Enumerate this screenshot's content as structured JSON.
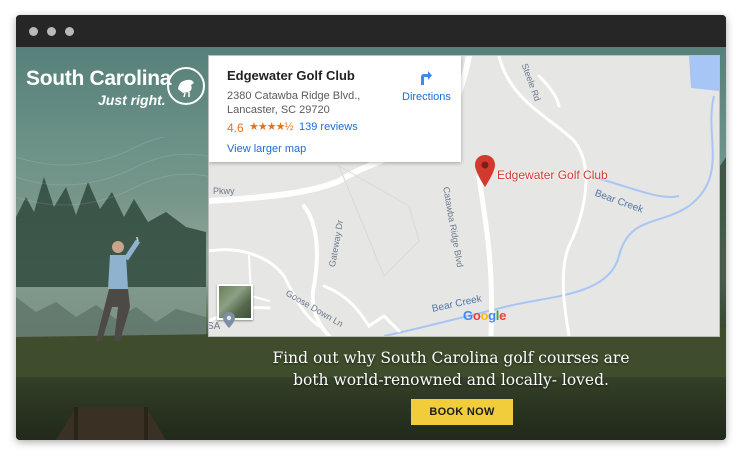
{
  "window": {
    "chrome_dots": [
      "close",
      "minimize",
      "maximize"
    ]
  },
  "brand": {
    "name": "South Carolina",
    "tagline": "Just right.",
    "badge_icon": "sc-bird-badge-icon"
  },
  "map": {
    "place_card": {
      "name": "Edgewater Golf Club",
      "address_line1": "2380 Catawba Ridge Blvd.,",
      "address_line2": "Lancaster, SC 29720",
      "rating": "4.6",
      "stars": "★★★★½",
      "reviews_link": "139 reviews",
      "larger_map_link": "View larger map",
      "directions_label": "Directions"
    },
    "marker_label": "Edgewater Golf Club",
    "road_labels": {
      "pkwy": "Pkwy",
      "catawba": "Catawba Ridge Blvd",
      "gateway": "Gateway Dr",
      "goose_down": "Goose Down Ln",
      "steele": "Steele Rd",
      "sa": "SA",
      "bear_creek_1": "Bear Creek",
      "bear_creek_2": "Bear Creek"
    },
    "google_logo": "Google",
    "colors": {
      "marker": "#d23a2f",
      "link": "#1a6cd6",
      "rating": "#e7711b",
      "water": "#a8c6f5"
    }
  },
  "promo": {
    "line1": "Find out why South Carolina golf courses are",
    "line2": "both world-renowned and locally- loved.",
    "cta_label": "BOOK NOW",
    "cta_color": "#f2cd3b"
  }
}
